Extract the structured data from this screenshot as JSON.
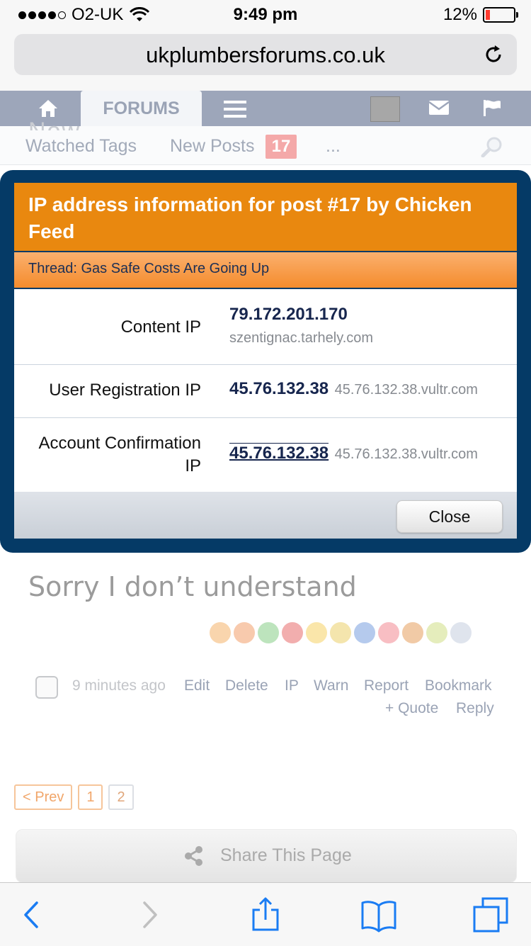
{
  "status_bar": {
    "carrier": "O2-UK",
    "time": "9:49 pm",
    "battery": "12%"
  },
  "browser": {
    "url": "ukplumbersforums.co.uk"
  },
  "site_nav": {
    "forums_tab": "FORUMS",
    "obscured_text": "Now ... ... ... ... ... ... ..."
  },
  "sub_nav": {
    "watched_tags": "Watched Tags",
    "new_posts": "New Posts",
    "new_posts_count": "17",
    "more": "..."
  },
  "dialog": {
    "title": "IP address information for post #17 by Chicken Feed",
    "thread": "Thread: Gas Safe Costs Are Going Up",
    "rows": [
      {
        "label": "Content IP",
        "ip": "79.172.201.170",
        "host": "szentignac.tarhely.com"
      },
      {
        "label": "User Registration IP",
        "ip": "45.76.132.38",
        "host": "45.76.132.38.vultr.com"
      },
      {
        "label": "Account Confirmation IP",
        "ip": "45.76.132.38",
        "host": "45.76.132.38.vultr.com"
      }
    ],
    "close_label": "Close"
  },
  "post": {
    "text": "Sorry I don’t understand",
    "time": "9 minutes ago",
    "actions": [
      "Edit",
      "Delete",
      "IP",
      "Warn",
      "Report",
      "Bookmark",
      "+ Quote",
      "Reply"
    ]
  },
  "pager": {
    "prev": "< Prev",
    "pages": [
      "1",
      "2"
    ]
  },
  "share": {
    "label": "Share This Page"
  },
  "colors": {
    "accent_orange": "#e9880f",
    "overlay_blue": "#053a66",
    "ios_blue": "#1a7cf3"
  }
}
